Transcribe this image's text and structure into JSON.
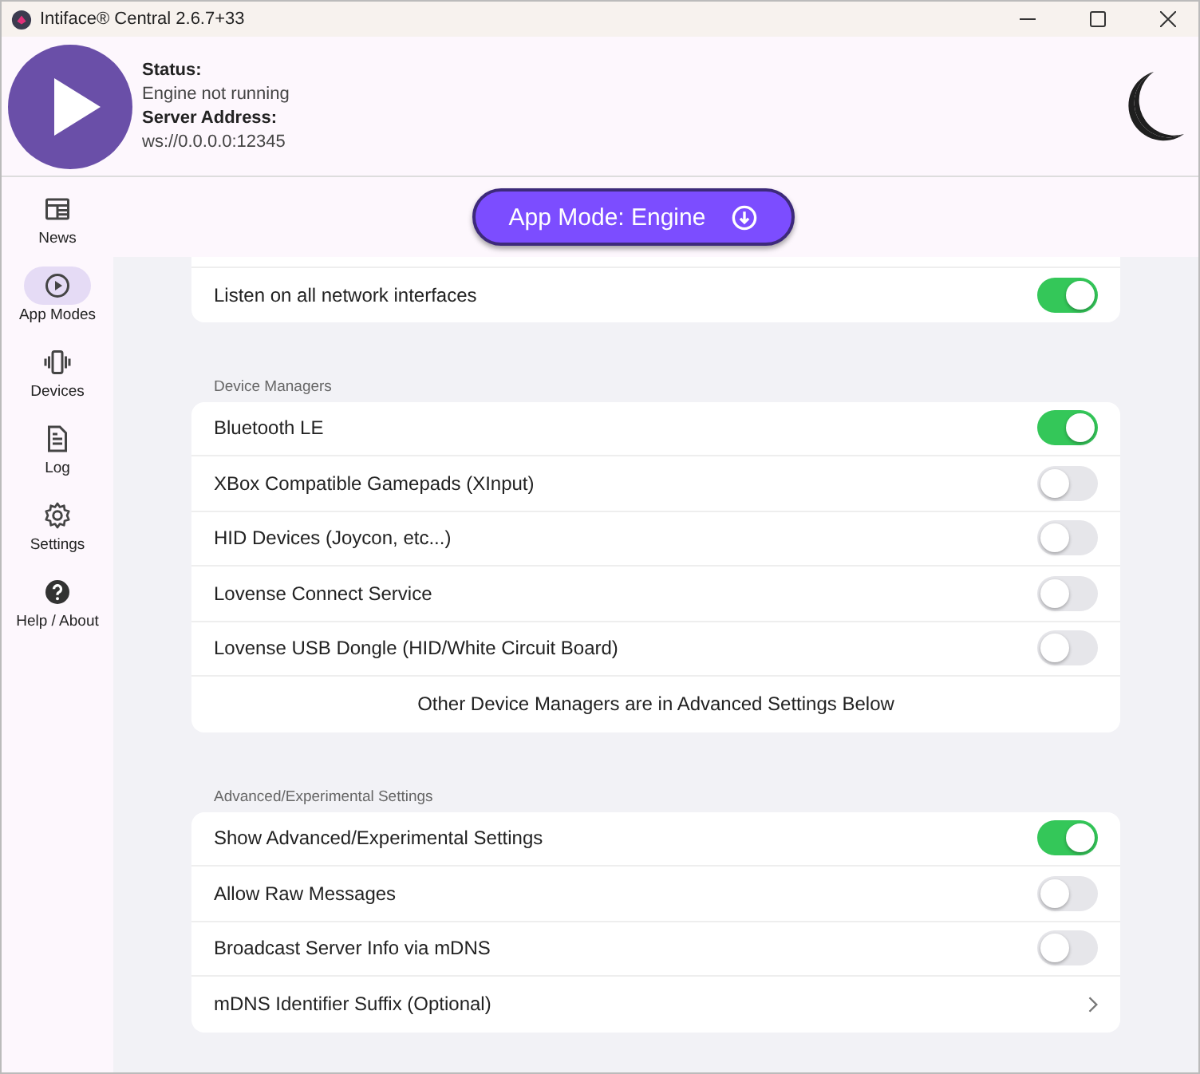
{
  "window": {
    "title": "Intiface® Central 2.6.7+33"
  },
  "status": {
    "running": false,
    "status_label": "Status:",
    "status_value": "Engine not running",
    "address_label": "Server Address:",
    "address_value": "ws://0.0.0.0:12345"
  },
  "sidebar": {
    "items": [
      {
        "label": "News",
        "kind": "news",
        "selected": false
      },
      {
        "label": "App Modes",
        "kind": "modes",
        "selected": true
      },
      {
        "label": "Devices",
        "kind": "devices",
        "selected": false
      },
      {
        "label": "Log",
        "kind": "log",
        "selected": false
      },
      {
        "label": "Settings",
        "kind": "settings",
        "selected": false
      },
      {
        "label": "Help / About",
        "kind": "help",
        "selected": false
      }
    ]
  },
  "app_mode_button": {
    "label": "App Mode: Engine"
  },
  "sections": [
    {
      "rows": [
        {
          "kind": "toggle",
          "label": "Listen on all network interfaces",
          "on": true
        }
      ]
    },
    {
      "header": "Device Managers",
      "rows": [
        {
          "kind": "toggle",
          "label": "Bluetooth LE",
          "on": true
        },
        {
          "kind": "toggle",
          "label": "XBox Compatible Gamepads (XInput)",
          "on": false
        },
        {
          "kind": "toggle",
          "label": "HID Devices (Joycon, etc...)",
          "on": false
        },
        {
          "kind": "toggle",
          "label": "Lovense Connect Service",
          "on": false
        },
        {
          "kind": "toggle",
          "label": "Lovense USB Dongle (HID/White Circuit Board)",
          "on": false
        },
        {
          "kind": "note",
          "label": "Other Device Managers are in Advanced Settings Below"
        }
      ]
    },
    {
      "header": "Advanced/Experimental Settings",
      "rows": [
        {
          "kind": "toggle",
          "label": "Show Advanced/Experimental Settings",
          "on": true
        },
        {
          "kind": "toggle",
          "label": "Allow Raw Messages",
          "on": false
        },
        {
          "kind": "toggle",
          "label": "Broadcast Server Info via mDNS",
          "on": false
        },
        {
          "kind": "link",
          "label": "mDNS Identifier Suffix (Optional)"
        }
      ]
    }
  ]
}
